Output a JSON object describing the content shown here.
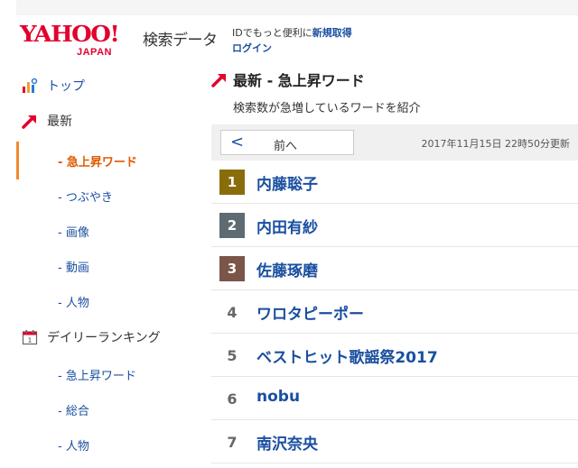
{
  "header": {
    "logo_text": "YAHOO!",
    "logo_sub": "JAPAN",
    "site_name": "検索データ",
    "login_text": "IDでもっと便利に",
    "register_link": "新規取得",
    "login_link": "ログイン"
  },
  "sidebar": {
    "top": "トップ",
    "latest": "最新",
    "latest_items": [
      "- 急上昇ワード",
      "- つぶやき",
      "- 画像",
      "- 動画",
      "- 人物"
    ],
    "daily": "デイリーランキング",
    "daily_items": [
      "- 急上昇ワード",
      "- 総合",
      "- 人物"
    ]
  },
  "main": {
    "title": "最新 - 急上昇ワード",
    "description": "検索数が急増しているワードを紹介",
    "prev_arrow": "<",
    "prev_label": "前へ",
    "updated": "2017年11月15日 22時50分更新",
    "ranking": [
      {
        "rank": "1",
        "word": "内藤聡子"
      },
      {
        "rank": "2",
        "word": "内田有紗"
      },
      {
        "rank": "3",
        "word": "佐藤琢磨"
      },
      {
        "rank": "4",
        "word": "ワロタピーポー"
      },
      {
        "rank": "5",
        "word": "ベストヒット歌謡祭2017"
      },
      {
        "rank": "6",
        "word": "nobu"
      },
      {
        "rank": "7",
        "word": "南沢奈央"
      }
    ]
  },
  "colors": {
    "link": "#1a4fa0",
    "brand_red": "#e2002e",
    "active_orange": "#e05a00",
    "gold": "#8a6d0b",
    "silver": "#5e6b72",
    "bronze": "#7a5548"
  }
}
